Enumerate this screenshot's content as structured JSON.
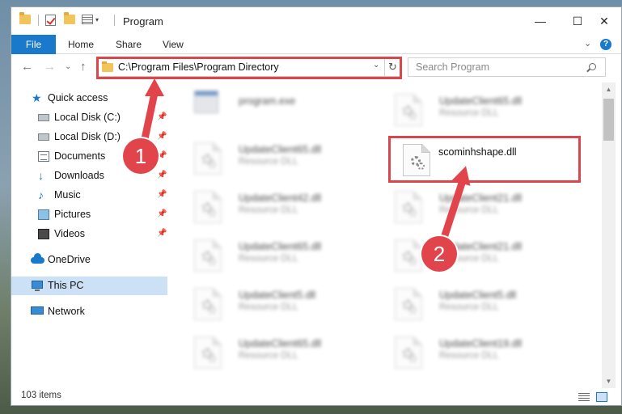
{
  "window": {
    "title": "Program",
    "min_icon": "—",
    "max_icon": "☐",
    "close_icon": "✕"
  },
  "ribbon": {
    "file": "File",
    "home": "Home",
    "share": "Share",
    "view": "View",
    "expand_icon": "⌄",
    "help": "?"
  },
  "nav": {
    "back": "←",
    "forward": "→",
    "recent": "⌄",
    "up": "↑",
    "address": "C:\\Program Files\\Program Directory",
    "address_drop": "⌄",
    "refresh": "↻",
    "search_placeholder": "Search Program"
  },
  "sidebar": {
    "items": [
      {
        "label": "Quick access"
      },
      {
        "label": "Local Disk (C:)",
        "pin": "📌"
      },
      {
        "label": "Local Disk (D:)",
        "pin": "📌"
      },
      {
        "label": "Documents",
        "pin": "📌"
      },
      {
        "label": "Downloads",
        "pin": "📌"
      },
      {
        "label": "Music",
        "pin": "📌"
      },
      {
        "label": "Pictures",
        "pin": "📌"
      },
      {
        "label": "Videos",
        "pin": "📌"
      },
      {
        "label": "OneDrive"
      },
      {
        "label": "This PC"
      },
      {
        "label": "Network"
      }
    ]
  },
  "files": [
    {
      "name": "program.exe",
      "type": ""
    },
    {
      "name": "UpdateClient65.dll",
      "type": "Resource DLL"
    },
    {
      "name": "UpdateClient65.dll",
      "type": "Resource DLL"
    },
    {
      "name": "scominhshape.dll",
      "type": ""
    },
    {
      "name": "UpdateClient42.dll",
      "type": "Resource DLL"
    },
    {
      "name": "UpdateClient21.dll",
      "type": "Resource DLL"
    },
    {
      "name": "UpdateClient65.dll",
      "type": "Resource DLL"
    },
    {
      "name": "UpdateClient21.dll",
      "type": "Resource DLL"
    },
    {
      "name": "UpdateClient5.dll",
      "type": "Resource DLL"
    },
    {
      "name": "UpdateClient5.dll",
      "type": "Resource DLL"
    },
    {
      "name": "UpdateClient65.dll",
      "type": "Resource DLL"
    },
    {
      "name": "UpdateClient19.dll",
      "type": "Resource DLL"
    }
  ],
  "status": {
    "count": "103 items"
  },
  "annotations": {
    "badge1": "1",
    "badge2": "2"
  },
  "colors": {
    "accent": "#1979ca",
    "highlight": "#d9464b",
    "selected": "#cce1f5"
  }
}
